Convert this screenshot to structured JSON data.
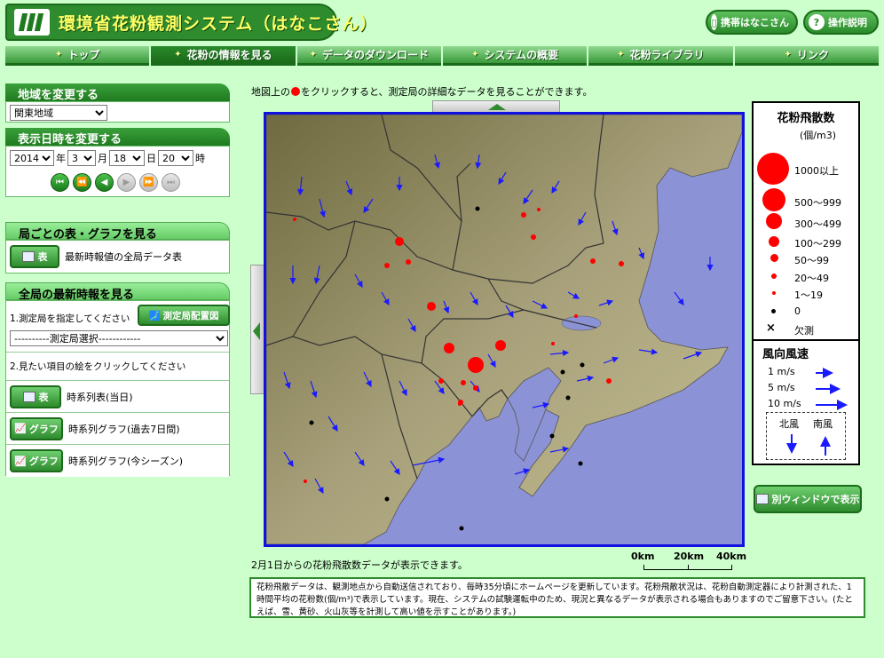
{
  "header": {
    "title": "環境省花粉観測システム（はなこさん）",
    "mobile_button": "携帯はなこさん",
    "help_button": "操作説明"
  },
  "nav": {
    "tabs": [
      "トップ",
      "花粉の情報を見る",
      "データのダウンロード",
      "システムの概要",
      "花粉ライブラリ",
      "リンク"
    ]
  },
  "region_panel": {
    "title": "地域を変更する",
    "selected": "関東地域"
  },
  "datetime_panel": {
    "title": "表示日時を変更する",
    "year": "2014",
    "year_label": "年",
    "month": "3",
    "month_label": "月",
    "day": "18",
    "day_label": "日",
    "hour": "20",
    "hour_label": "時"
  },
  "station_panel": {
    "title": "局ごとの表・グラフを見る",
    "table_button": "表",
    "table_desc": "最新時報値の全局データ表"
  },
  "latest_panel": {
    "title": "全局の最新時報を見る",
    "step1": "1.測定局を指定してください",
    "map_button": "測定局配置図",
    "station_select": "----------測定局選択------------",
    "step2": "2.見たい項目の絵をクリックしてください",
    "items": [
      {
        "button": "表",
        "desc": "時系列表(当日)"
      },
      {
        "button": "グラフ",
        "desc": "時系列グラフ(過去7日間)"
      },
      {
        "button": "グラフ",
        "desc": "時系列グラフ(今シーズン)"
      }
    ]
  },
  "map": {
    "instruction_pre": "地図上の",
    "instruction_post": "をクリックすると、測定局の詳細なデータを見ることができます。",
    "date_note": "2月1日からの花粉飛散数データが表示できます。",
    "scale_labels": [
      "0km",
      "20km",
      "40km"
    ]
  },
  "legend": {
    "pollen_title": "花粉飛散数",
    "pollen_unit": "(個/m3)",
    "pollen_levels": [
      "1000以上",
      "500〜999",
      "300〜499",
      "100〜299",
      "50〜99",
      "20〜49",
      "1〜19",
      "0",
      "欠測"
    ],
    "missing_mark": "×",
    "wind_title": "風向風速",
    "wind_levels": [
      "1 m/s",
      "5 m/s",
      "10 m/s"
    ],
    "north_wind": "北風",
    "south_wind": "南風"
  },
  "new_window_button": "別ウィンドウで表示",
  "footer_note": "花粉飛散データは、観測地点から自動送信されており、毎時35分頃にホームページを更新しています。花粉飛散状況は、花粉自動測定器により計測された、1時間平均の花粉数(個/m³)で表示しています。現在、システムの試験運転中のため、現況と異なるデータが表示される場合もありますのでご留意下さい。(たとえば、雪、黄砂、火山灰等を計測して高い値を示すことがあります。)",
  "colors": {
    "page_bg": "#ccffcc",
    "brand_green": "#2e8b2e",
    "map_border": "#1010e0",
    "pollen_red": "#ff0000",
    "wind_blue": "#1a1aff"
  }
}
